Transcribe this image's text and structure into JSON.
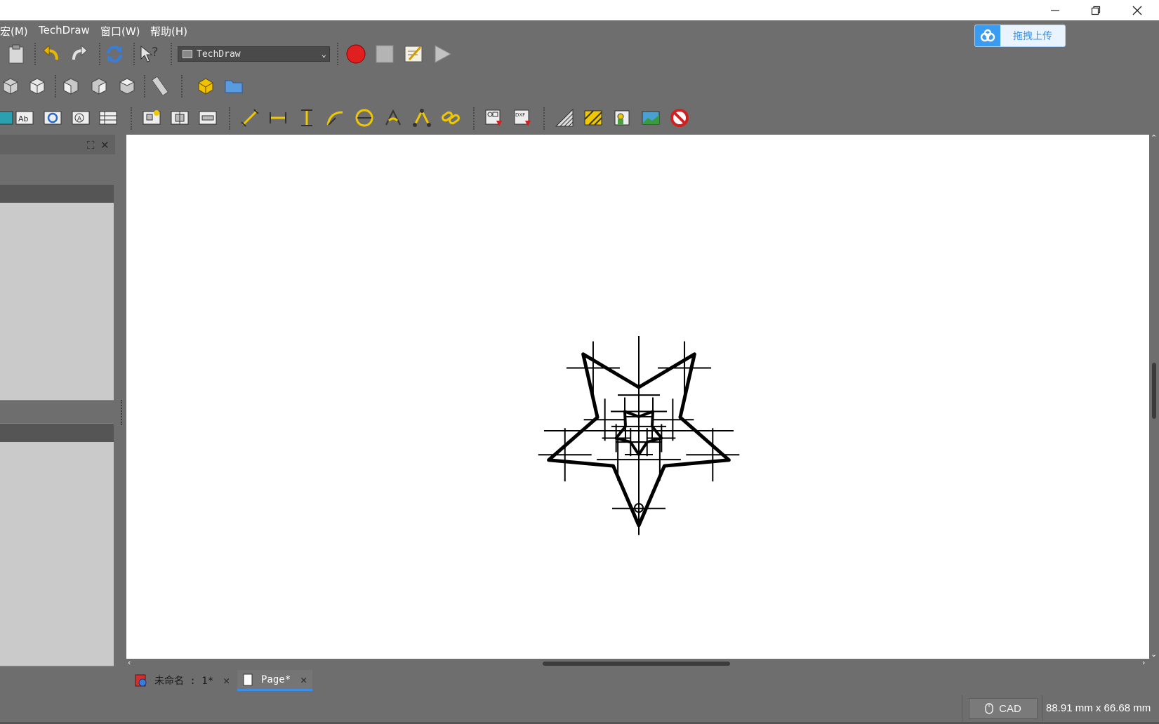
{
  "window": {
    "minimize_icon": "minimize-icon",
    "restore_icon": "restore-icon",
    "close_icon": "close-icon"
  },
  "menu": {
    "items": [
      "宏(M)",
      "TechDraw",
      "窗口(W)",
      "帮助(H)"
    ]
  },
  "cloud_upload": {
    "label": "拖拽上传",
    "icon": "cloud-icon"
  },
  "toolbar": {
    "workbench": "TechDraw",
    "row1": [
      "paste-icon",
      "undo-icon",
      "redo-icon",
      "refresh-icon",
      "whats-this-icon",
      "record-macro-icon",
      "stop-macro-icon",
      "edit-macro-icon",
      "run-macro-icon"
    ],
    "row2": [
      "view-iso-icon",
      "view-front-icon",
      "view-top-icon",
      "view-right-icon",
      "view-rear-icon",
      "measure-icon",
      "part-icon",
      "open-folder-icon"
    ],
    "row3": [
      "insert-view-icon",
      "annotation-icon",
      "clip-icon",
      "symbol-icon",
      "spreadsheet-icon",
      "projection-group-icon",
      "section-view-icon",
      "detail-view-icon",
      "length-dim-icon",
      "horizontal-dim-icon",
      "vertical-dim-icon",
      "radius-dim-icon",
      "diameter-dim-icon",
      "angle-dim-icon",
      "three-point-angle-icon",
      "link-dim-icon",
      "export-svg-icon",
      "export-dxf-icon",
      "hatch-icon",
      "geom-hatch-icon",
      "image-icon",
      "toggle-frame-icon",
      "forbidden-icon"
    ]
  },
  "colors": {
    "background": "#6e6e6e",
    "canvas": "#ffffff",
    "record": "#e02020",
    "accent": "#3b8fe8"
  },
  "tabs": [
    {
      "label": "未命名 : 1*",
      "icon": "freecad-doc-icon"
    },
    {
      "label": "Page*",
      "icon": "page-icon"
    }
  ],
  "status": {
    "nav_style": "CAD",
    "dimensions": "88.91 mm x 66.68 mm"
  }
}
